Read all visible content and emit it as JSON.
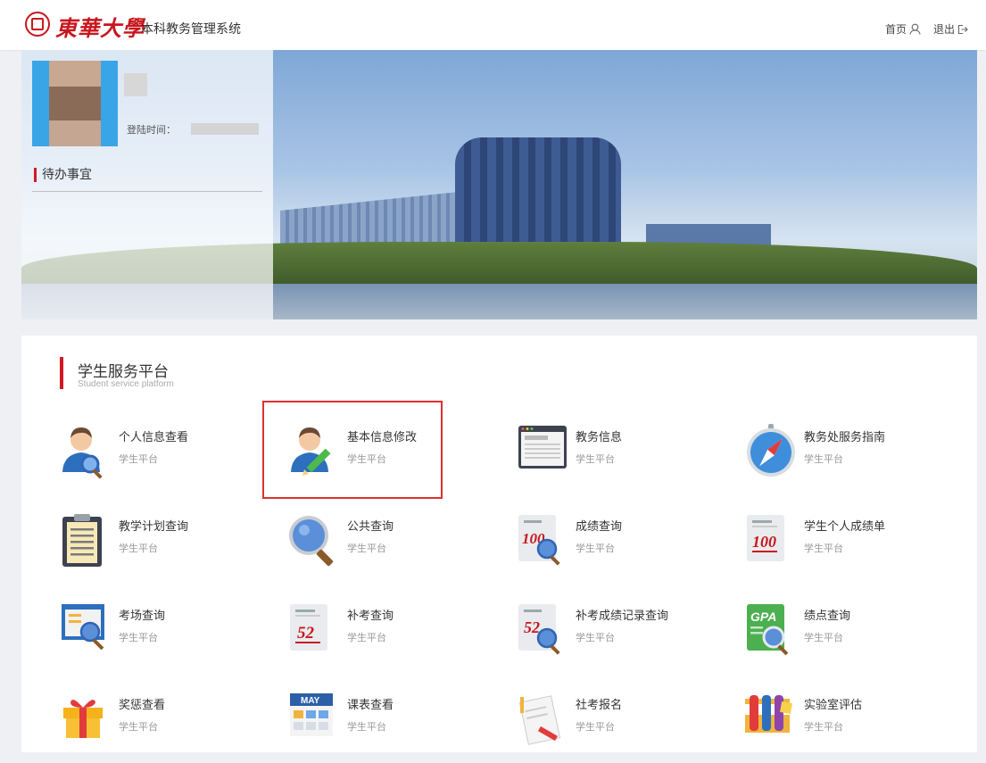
{
  "header": {
    "logo_text": "東華大學",
    "system_name": "本科教务管理系统",
    "home_label": "首页",
    "logout_label": "退出"
  },
  "banner": {
    "login_time_label": "登陆时间：",
    "todo_label": "待办事宜"
  },
  "platform": {
    "title": "学生服务平台",
    "subtitle": "Student service platform",
    "tiles": [
      {
        "title": "个人信息查看",
        "sub": "学生平台",
        "icon": "user-magnifier-icon"
      },
      {
        "title": "基本信息修改",
        "sub": "学生平台",
        "icon": "user-pencil-icon"
      },
      {
        "title": "教务信息",
        "sub": "学生平台",
        "icon": "browser-window-icon"
      },
      {
        "title": "教务处服务指南",
        "sub": "学生平台",
        "icon": "compass-icon"
      },
      {
        "title": "教学计划查询",
        "sub": "学生平台",
        "icon": "clipboard-icon"
      },
      {
        "title": "公共查询",
        "sub": "学生平台",
        "icon": "magnifier-icon"
      },
      {
        "title": "成绩查询",
        "sub": "学生平台",
        "icon": "score-100-magnifier-icon"
      },
      {
        "title": "学生个人成绩单",
        "sub": "学生平台",
        "icon": "score-100-sheet-icon"
      },
      {
        "title": "考场查询",
        "sub": "学生平台",
        "icon": "exam-room-icon"
      },
      {
        "title": "补考查询",
        "sub": "学生平台",
        "icon": "score-52-sheet-icon"
      },
      {
        "title": "补考成绩记录查询",
        "sub": "学生平台",
        "icon": "score-52-magnifier-icon"
      },
      {
        "title": "绩点查询",
        "sub": "学生平台",
        "icon": "gpa-icon"
      },
      {
        "title": "奖惩查看",
        "sub": "学生平台",
        "icon": "gift-icon"
      },
      {
        "title": "课表查看",
        "sub": "学生平台",
        "icon": "calendar-icon"
      },
      {
        "title": "社考报名",
        "sub": "学生平台",
        "icon": "notepad-pencil-icon"
      },
      {
        "title": "实验室评估",
        "sub": "学生平台",
        "icon": "test-tubes-icon"
      }
    ],
    "icon_text": {
      "score_100": "100",
      "score_52": "52",
      "gpa": "GPA",
      "calendar_month": "MAY"
    }
  },
  "colors": {
    "accent_red": "#d31922",
    "icon_blue": "#2d6fbd",
    "highlight_border": "#e03030"
  }
}
